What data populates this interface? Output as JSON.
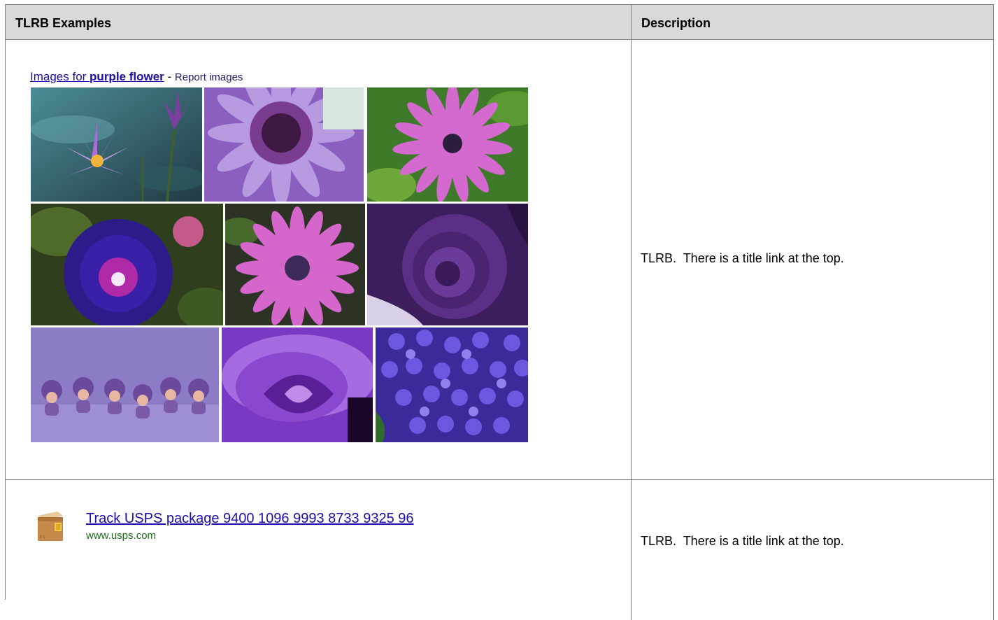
{
  "table": {
    "headers": [
      "TLRB Examples",
      "Description"
    ],
    "rows": [
      {
        "example": {
          "link_text": "Images for ",
          "query": "purple flower",
          "separator": " - ",
          "report": "Report images"
        },
        "description": "TLRB.  There is a title link at the top."
      },
      {
        "example": {
          "title": "Track USPS package 9400 1096 9993 8733 9325 96",
          "url": "www.usps.com"
        },
        "description": "TLRB.  There is a title link at the top."
      }
    ]
  },
  "icons": [
    "water-lily-photo",
    "gerbera-closeup-photo",
    "osteospermum-photo",
    "morning-glory-photo",
    "wet-gerbera-photo",
    "purple-rose-photo",
    "babies-in-costume-photo",
    "purple-rose-closeup-photo",
    "lilac-blossoms-photo",
    "package-box-icon"
  ],
  "colors": {
    "link": "#1a0dab",
    "url_green": "#1d6b1d",
    "header_bg": "#d9d9d9",
    "border": "#7f7f7f"
  }
}
